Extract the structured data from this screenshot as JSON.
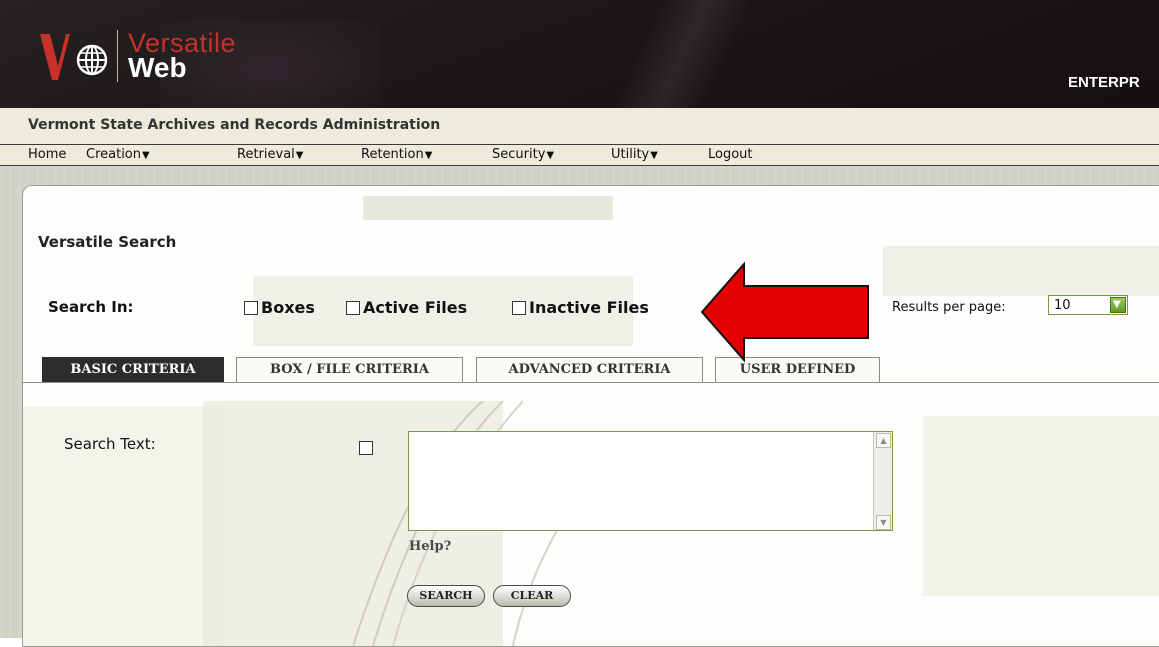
{
  "header": {
    "brand_line1": "Versatile",
    "brand_line2": "Web",
    "edition": "ENTERPR"
  },
  "org": {
    "title": "Vermont State Archives and Records Administration"
  },
  "nav": {
    "items": [
      {
        "label": "Home",
        "has_dropdown": false
      },
      {
        "label": "Creation",
        "has_dropdown": true
      },
      {
        "label": "Retrieval",
        "has_dropdown": true
      },
      {
        "label": "Retention",
        "has_dropdown": true
      },
      {
        "label": "Security",
        "has_dropdown": true
      },
      {
        "label": "Utility",
        "has_dropdown": true
      },
      {
        "label": "Logout",
        "has_dropdown": false
      }
    ],
    "caret": "▼"
  },
  "search": {
    "section_title": "Versatile Search",
    "search_in_label": "Search In:",
    "scopes": [
      {
        "label": "Boxes",
        "checked": false
      },
      {
        "label": "Active Files",
        "checked": false
      },
      {
        "label": "Inactive Files",
        "checked": false
      }
    ],
    "results_per_page_label": "Results per page:",
    "results_per_page_value": "10",
    "tabs": [
      {
        "label": "BASIC CRITERIA",
        "active": true
      },
      {
        "label": "BOX / FILE CRITERIA",
        "active": false
      },
      {
        "label": "ADVANCED CRITERIA",
        "active": false
      },
      {
        "label": "USER DEFINED",
        "active": false
      }
    ],
    "search_text_label": "Search Text:",
    "search_text_value": "",
    "help_label": "Help?",
    "buttons": {
      "search": "SEARCH",
      "clear": "CLEAR"
    }
  },
  "colors": {
    "header_bg": "#1b1717",
    "brand_red": "#c8302a",
    "nav_bg": "#ecebdc",
    "active_tab_bg": "#2c2c2c",
    "annotation_red": "#e30000",
    "field_border": "#7c9a3c"
  },
  "icons": {
    "logo": "versatile-globe-logo",
    "dropdown": "chevron-down-icon",
    "scroll_up": "scroll-up-arrow-icon",
    "scroll_down": "scroll-down-arrow-icon",
    "annotation": "red-left-arrow-annotation"
  }
}
